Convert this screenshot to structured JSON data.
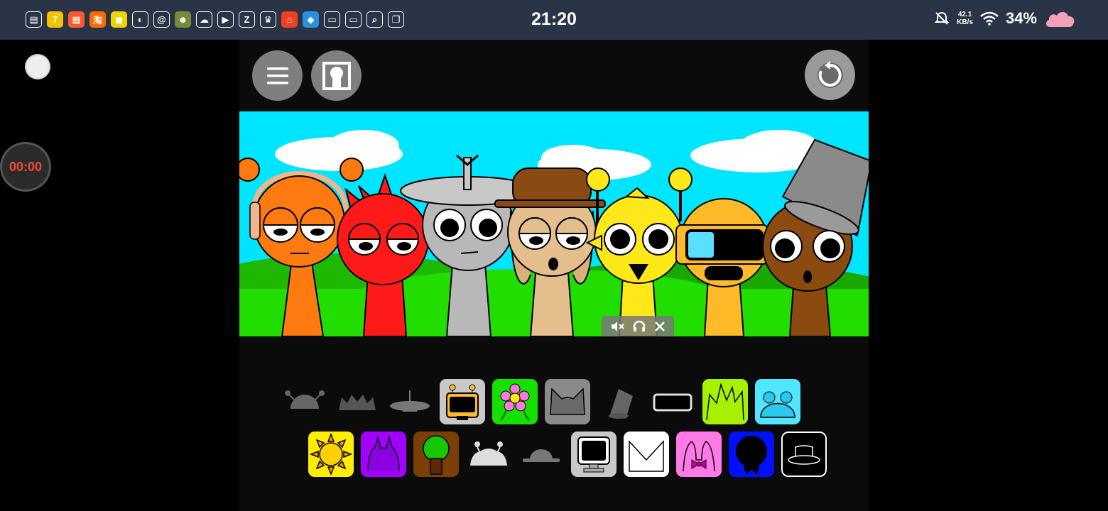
{
  "status_bar": {
    "time": "21:20",
    "network_speed_value": "42.1",
    "network_speed_unit": "KB/s",
    "battery": "34%",
    "app_icons": [
      {
        "name": "doc-icon",
        "color": "#ffffff",
        "glyph": "▤"
      },
      {
        "name": "seven-icon",
        "color": "#f5c400",
        "glyph": "7"
      },
      {
        "name": "grid-app-icon",
        "color": "#ff5a2e",
        "glyph": "▦"
      },
      {
        "name": "taobao-icon",
        "color": "#ff6a00",
        "glyph": "淘"
      },
      {
        "name": "yellow-app-icon",
        "color": "#f0d400",
        "glyph": "◼"
      },
      {
        "name": "leaf-icon",
        "color": "#e0e0e0",
        "glyph": "◐"
      },
      {
        "name": "mail-icon",
        "color": "#e0e0e0",
        "glyph": "@"
      },
      {
        "name": "character-icon",
        "color": "#7a8a3a",
        "glyph": "☻"
      },
      {
        "name": "cloud-icon",
        "color": "#e0e0e0",
        "glyph": "☁"
      },
      {
        "name": "play-icon",
        "color": "#e0e0e0",
        "glyph": "▶"
      },
      {
        "name": "z-app-icon",
        "color": "#e0e0e0",
        "glyph": "Z"
      },
      {
        "name": "crown-icon",
        "color": "#e0e0e0",
        "glyph": "♛"
      },
      {
        "name": "shop-icon",
        "color": "#f04020",
        "glyph": "⌂"
      },
      {
        "name": "blue-app-icon",
        "color": "#2a90e0",
        "glyph": "◆"
      },
      {
        "name": "card-icon",
        "color": "#e0e0e0",
        "glyph": "▭"
      },
      {
        "name": "card2-icon",
        "color": "#e0e0e0",
        "glyph": "▭"
      },
      {
        "name": "search-icon",
        "color": "#e0e0e0",
        "glyph": "⌕"
      },
      {
        "name": "book-icon",
        "color": "#e0e0e0",
        "glyph": "❐"
      }
    ]
  },
  "recorder": {
    "elapsed": "00:00"
  },
  "colors": {
    "sky": "#00e5ff",
    "grass": "#22dd00",
    "panel": "#0b0b0b",
    "button_gray": "#7f7f7f"
  },
  "stage_characters": [
    {
      "name": "orange-character",
      "color": "#ff7a10"
    },
    {
      "name": "red-character",
      "color": "#ff1a1a"
    },
    {
      "name": "gray-character",
      "color": "#b8b8b8"
    },
    {
      "name": "tan-character",
      "color": "#e4be8c"
    },
    {
      "name": "yellow-character",
      "color": "#ffe81a"
    },
    {
      "name": "gold-character",
      "color": "#ffba2a"
    },
    {
      "name": "brown-character",
      "color": "#8a4a10"
    }
  ],
  "palette_row1": [
    {
      "name": "antenna-dome-icon",
      "bg": "transparent"
    },
    {
      "name": "spiky-hair-icon",
      "bg": "transparent"
    },
    {
      "name": "satellite-dish-icon",
      "bg": "transparent"
    },
    {
      "name": "robot-head-icon",
      "bg": "#c8c8c8"
    },
    {
      "name": "flower-icon",
      "bg": "#16e000"
    },
    {
      "name": "cat-ears-icon",
      "bg": "#8a8a8a"
    },
    {
      "name": "bucket-hat-icon",
      "bg": "transparent"
    },
    {
      "name": "visor-icon",
      "bg": "transparent"
    },
    {
      "name": "green-spikes-icon",
      "bg": "#a6f000"
    },
    {
      "name": "bear-ears-icon",
      "bg": "#50e6ff"
    }
  ],
  "palette_row2": [
    {
      "name": "sun-icon",
      "bg": "#ffee00"
    },
    {
      "name": "purple-horns-icon",
      "bg": "#a400ff"
    },
    {
      "name": "tree-icon",
      "bg": "#7a3e06"
    },
    {
      "name": "crab-hair-icon",
      "bg": "transparent"
    },
    {
      "name": "bowler-hat-icon",
      "bg": "transparent"
    },
    {
      "name": "monitor-icon",
      "bg": "#c8c8c8"
    },
    {
      "name": "envelope-icon",
      "bg": "#ffffff"
    },
    {
      "name": "pink-bow-icon",
      "bg": "#ff7ae6"
    },
    {
      "name": "blue-medal-icon",
      "bg": "#0010ff"
    },
    {
      "name": "top-hat-icon",
      "bg": "#000000"
    }
  ]
}
